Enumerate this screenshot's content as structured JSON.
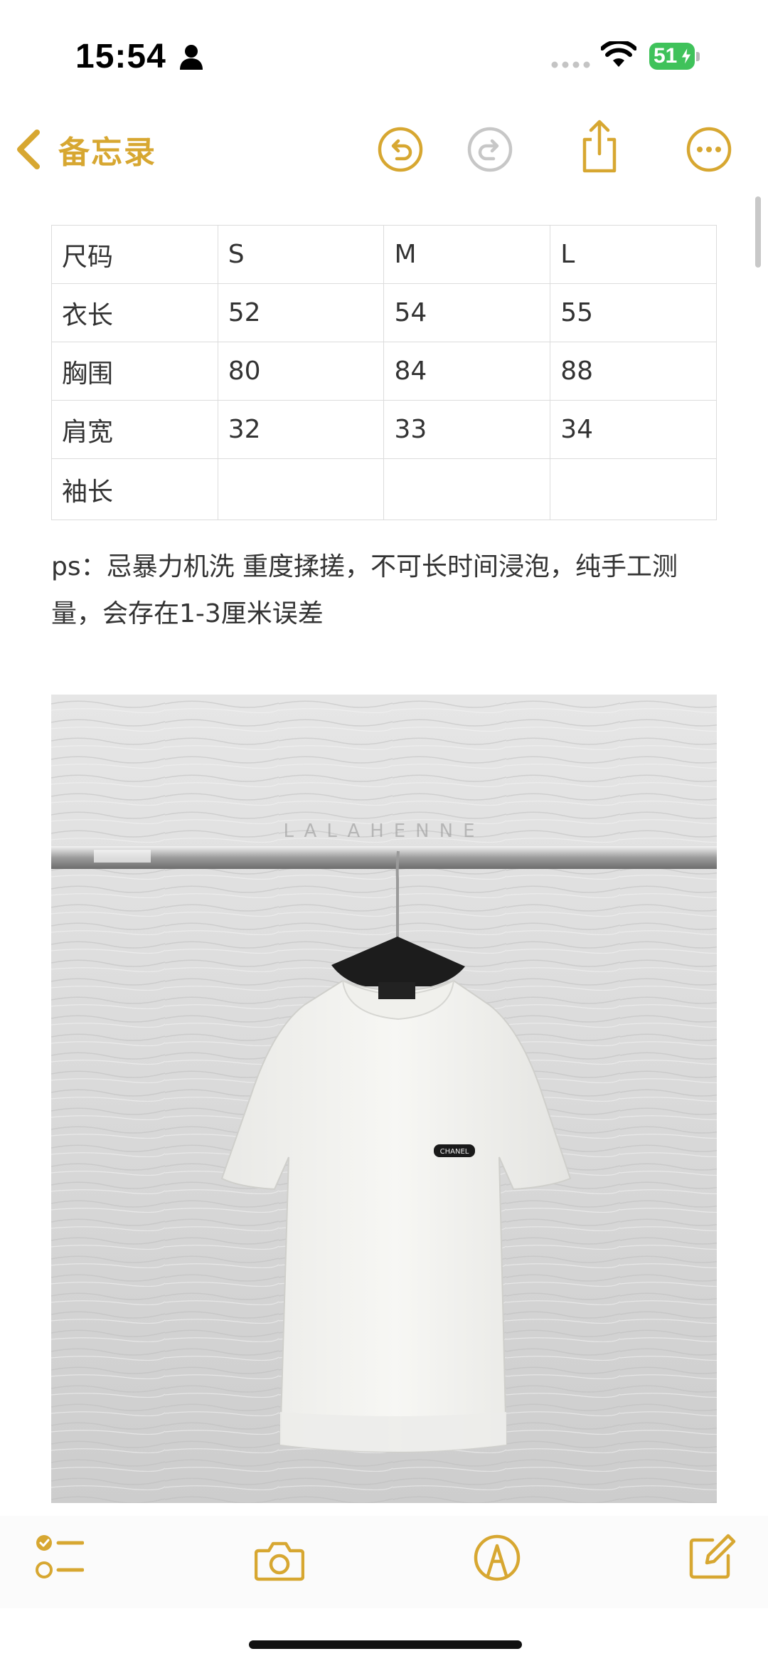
{
  "status_bar": {
    "time": "15:54",
    "battery": "51"
  },
  "nav": {
    "back_label": "备忘录"
  },
  "size_table": {
    "rows": [
      [
        "尺码",
        "S",
        "M",
        "L"
      ],
      [
        "衣长",
        "52",
        "54",
        "55"
      ],
      [
        "胸围",
        "80",
        "84",
        "88"
      ],
      [
        "肩宽",
        "32",
        "33",
        "34"
      ],
      [
        "袖长",
        "",
        "",
        ""
      ]
    ]
  },
  "note": {
    "text": "ps：忌暴力机洗 重度揉搓，不可长时间浸泡，纯手工测量，会存在1-3厘米误差"
  },
  "photo": {
    "watermark": "LALAHENNE",
    "label_text": "CHANEL"
  },
  "colors": {
    "accent": "#d7a731",
    "battery": "#3fc25a",
    "disabled": "#c7c7c7"
  },
  "icons": [
    "person-icon",
    "wifi-icon",
    "back-chevron-icon",
    "undo-icon",
    "redo-icon",
    "share-icon",
    "more-icon",
    "checklist-icon",
    "camera-icon",
    "markup-icon",
    "compose-icon"
  ]
}
